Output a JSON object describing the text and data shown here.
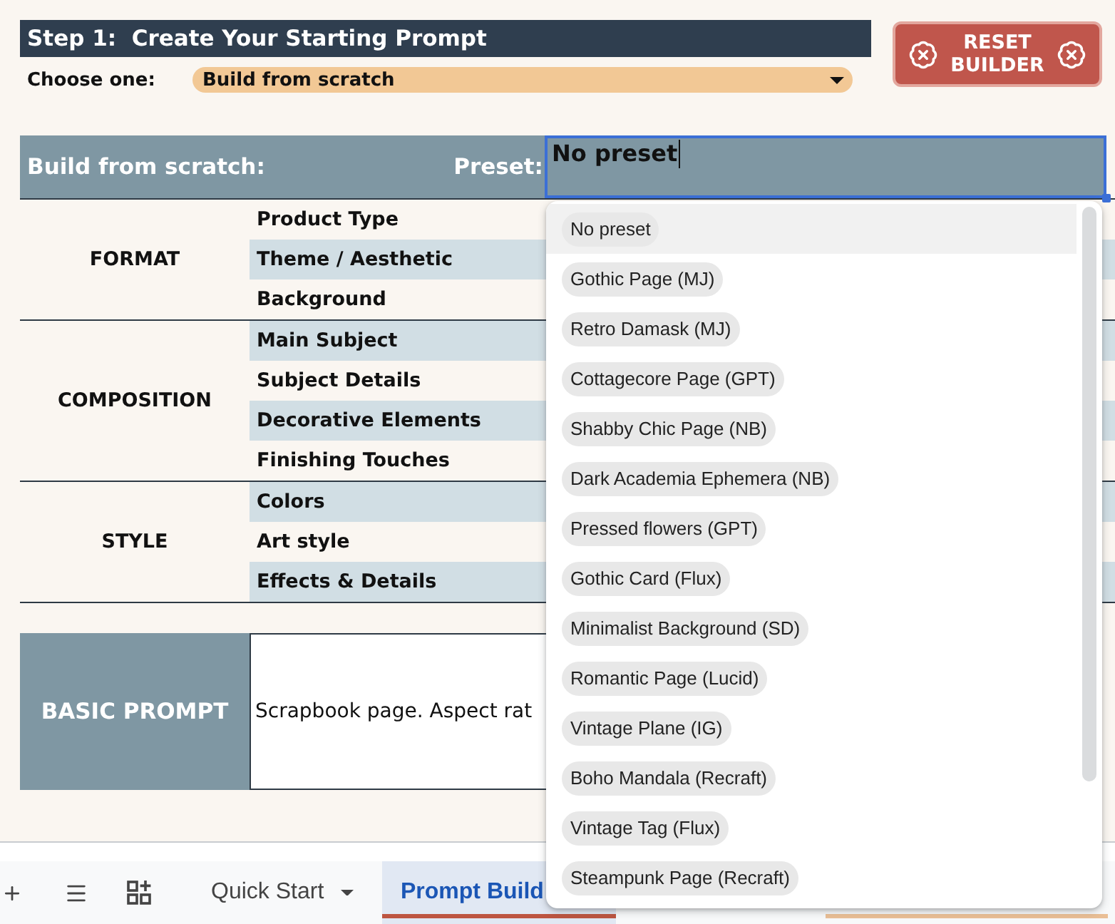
{
  "step": {
    "title": "Step 1:  Create Your Starting Prompt",
    "choose_label": "Choose one:",
    "choice": "Build from scratch"
  },
  "reset_button": {
    "label": "RESET BUILDER"
  },
  "builder_header": {
    "title": "Build from scratch:",
    "preset_label": "Preset:",
    "preset_value": "No preset"
  },
  "sections": [
    {
      "name": "FORMAT",
      "fields": [
        "Product Type",
        "Theme / Aesthetic",
        "Background"
      ]
    },
    {
      "name": "COMPOSITION",
      "fields": [
        "Main Subject",
        "Subject Details",
        "Decorative Elements",
        "Finishing Touches"
      ]
    },
    {
      "name": "STYLE",
      "fields": [
        "Colors",
        "Art style",
        "Effects & Details"
      ]
    }
  ],
  "basic_prompt": {
    "label": "BASIC PROMPT",
    "value": "Scrapbook page. Aspect rat"
  },
  "preset_menu": {
    "options": [
      {
        "label": "No preset",
        "selected": true
      },
      {
        "label": "Gothic Page (MJ)",
        "selected": false
      },
      {
        "label": "Retro Damask (MJ)",
        "selected": false
      },
      {
        "label": "Cottagecore Page (GPT)",
        "selected": false
      },
      {
        "label": "Shabby Chic Page (NB)",
        "selected": false
      },
      {
        "label": "Dark Academia Ephemera (NB)",
        "selected": false
      },
      {
        "label": "Pressed flowers (GPT)",
        "selected": false
      },
      {
        "label": "Gothic Card (Flux)",
        "selected": false
      },
      {
        "label": "Minimalist Background (SD)",
        "selected": false
      },
      {
        "label": "Romantic Page (Lucid)",
        "selected": false
      },
      {
        "label": "Vintage Plane (IG)",
        "selected": false
      },
      {
        "label": "Boho Mandala (Recraft)",
        "selected": false
      },
      {
        "label": "Vintage Tag (Flux)",
        "selected": false
      },
      {
        "label": "Steampunk Page (Recraft)",
        "selected": false
      }
    ]
  },
  "sheet_tabs": [
    {
      "label": "Quick Start",
      "selected": false,
      "dropdown_caret": true
    },
    {
      "label": "Prompt Build",
      "selected": true,
      "dropdown_caret": false,
      "color": "#bd5541"
    },
    {
      "color": "#eabf96"
    }
  ]
}
